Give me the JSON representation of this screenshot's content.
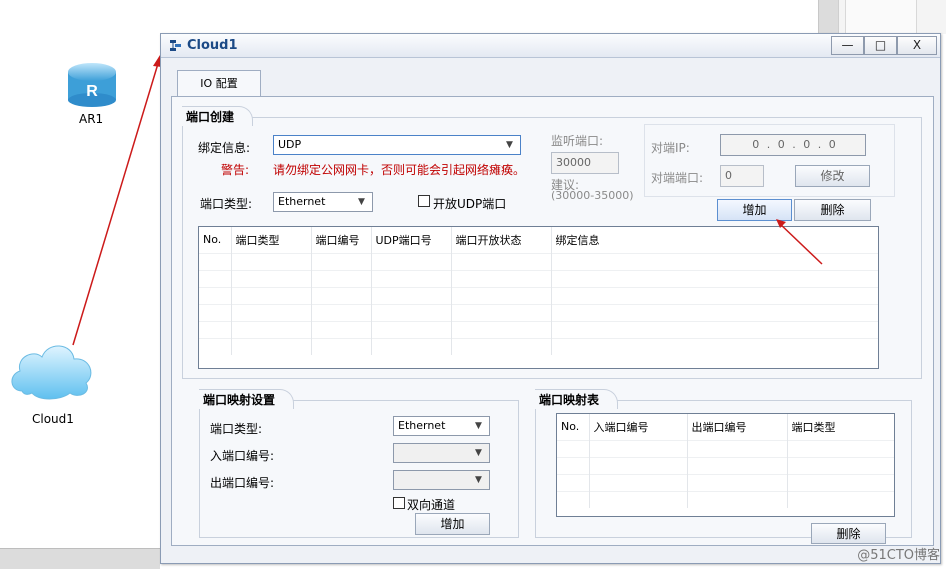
{
  "canvas": {
    "devices": {
      "router_label": "AR1",
      "cloud_label": "Cloud1"
    }
  },
  "window": {
    "title": "Cloud1",
    "buttons": {
      "minimize": "—",
      "maximize": "□",
      "close": "X"
    },
    "tab_label": "IO 配置"
  },
  "port_create": {
    "title": "端口创建",
    "bind_label": "绑定信息:",
    "bind_value": "UDP",
    "warning_label": "警告:",
    "warning_text": "请勿绑定公网网卡，否则可能会引起网络瘫痪。",
    "listen_port_label": "监听端口:",
    "listen_port_value": "30000",
    "suggest_label": "建议:",
    "suggest_range": "(30000-35000)",
    "peer_ip_label": "对端IP:",
    "peer_ip_value": "0 . 0 . 0 . 0",
    "peer_port_label": "对端端口:",
    "peer_port_value": "0",
    "modify_button": "修改",
    "port_type_label": "端口类型:",
    "port_type_value": "Ethernet",
    "open_udp_label": "开放UDP端口",
    "add_button": "增加",
    "delete_button": "删除",
    "table_headers": [
      "No.",
      "端口类型",
      "端口编号",
      "UDP端口号",
      "端口开放状态",
      "绑定信息"
    ]
  },
  "port_mapping": {
    "title": "端口映射设置",
    "port_type_label": "端口类型:",
    "port_type_value": "Ethernet",
    "in_port_label": "入端口编号:",
    "out_port_label": "出端口编号:",
    "bidirectional_label": "双向通道",
    "add_button": "增加"
  },
  "mapping_table": {
    "title": "端口映射表",
    "headers": [
      "No.",
      "入端口编号",
      "出端口编号",
      "端口类型"
    ],
    "delete_button": "删除"
  },
  "watermark": "@51CTO博客",
  "colors": {
    "link_line": "#cc1a1a",
    "title_text": "#1c4a86",
    "warning_text": "#c00000"
  }
}
